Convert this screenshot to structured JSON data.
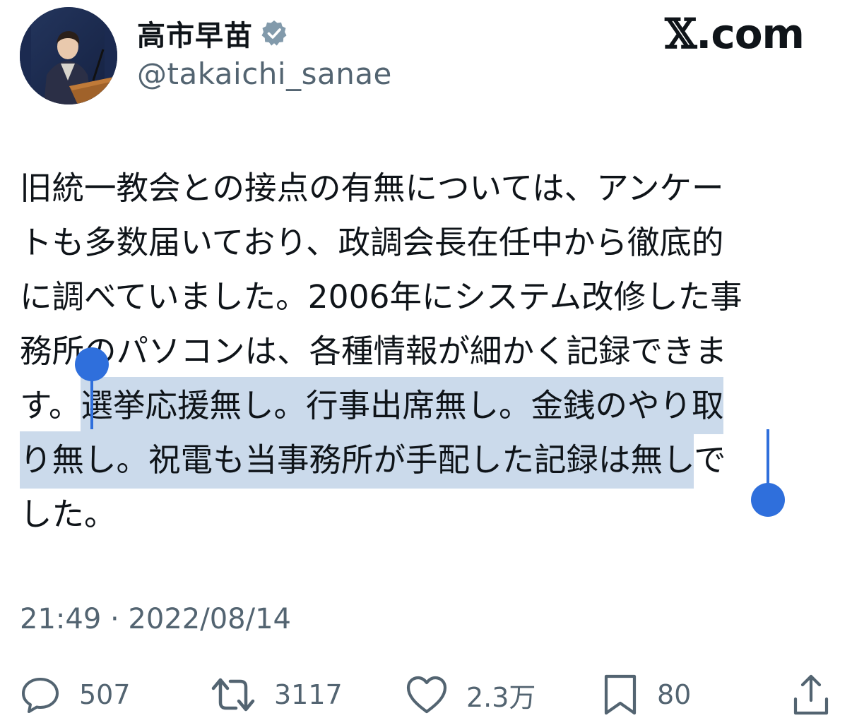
{
  "profile": {
    "display_name": "高市早苗",
    "handle": "@takaichi_sanae",
    "avatar_icon": "profile-photo-icon",
    "verified_icon": "verified-badge-icon"
  },
  "brand": {
    "x_letter": "𝕏",
    "suffix": ".com"
  },
  "tweet": {
    "lines": [
      {
        "plain": "旧統一教会との接点の有無については、アンケー"
      },
      {
        "plain": "トも多数届いており、政調会長在任中から徹底的"
      },
      {
        "plain": "に調べていました。2006年にシステム改修した事"
      },
      {
        "plain": "務所のパソコンは、各種情報が細かく記録できま"
      },
      {
        "before": "す。",
        "selected": "選挙応援無し。行事出席無し。金銭のやり取"
      },
      {
        "selected": "り無し。祝電も当事務所が手配した記録は無し",
        "after": "で"
      },
      {
        "plain": "した。"
      }
    ],
    "selection_color": "#cbdaeb",
    "handle_color": "#2f6fdc"
  },
  "meta": {
    "timestamp": "21:49 · 2022/08/14"
  },
  "actions": {
    "reply": {
      "icon": "reply-icon",
      "count": "507"
    },
    "retweet": {
      "icon": "retweet-icon",
      "count": "3117"
    },
    "like": {
      "icon": "heart-icon",
      "count": "2.3万"
    },
    "bookmark": {
      "icon": "bookmark-icon",
      "count": "80"
    },
    "share": {
      "icon": "share-icon"
    }
  }
}
